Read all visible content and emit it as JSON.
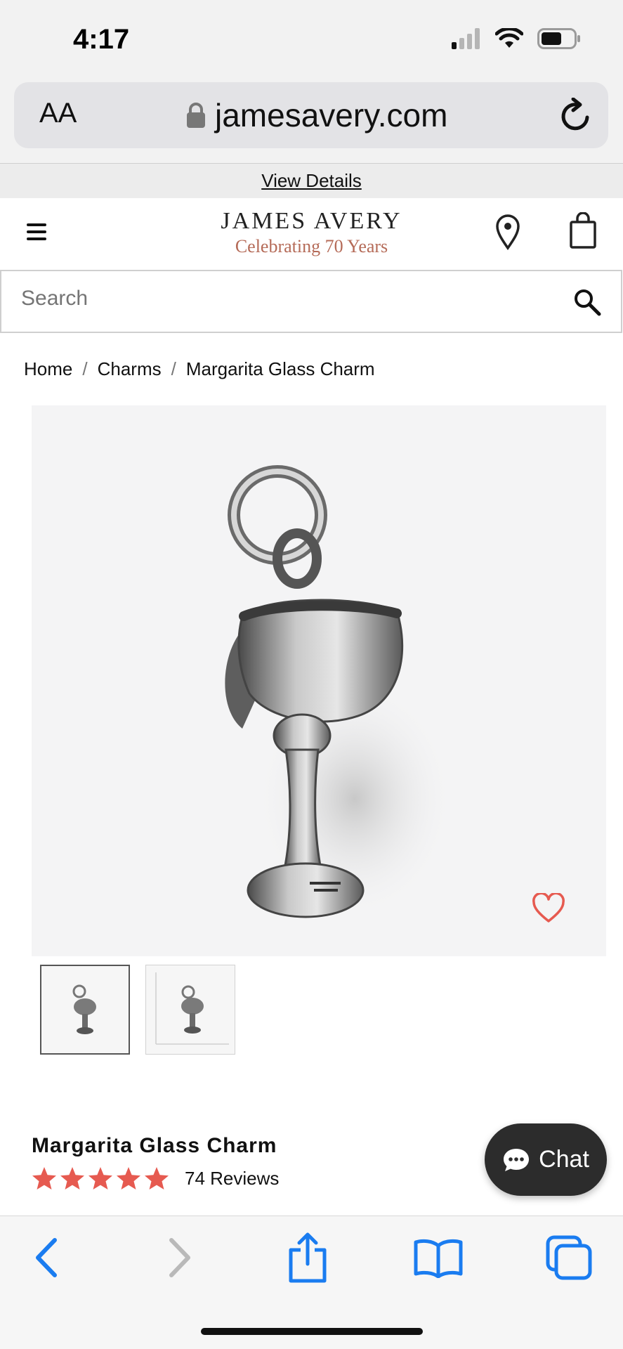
{
  "status_bar": {
    "time": "4:17"
  },
  "browser": {
    "text_size_label": "AA",
    "url": "jamesavery.com"
  },
  "promo_banner": {
    "link_label": "View Details"
  },
  "header": {
    "brand_name": "JAMES AVERY",
    "tagline": "Celebrating 70 Years"
  },
  "search": {
    "placeholder": "Search"
  },
  "breadcrumb": {
    "items": [
      "Home",
      "Charms",
      "Margarita Glass Charm"
    ],
    "separator": "/"
  },
  "product": {
    "title": "Margarita Glass Charm",
    "rating": 5,
    "reviews_label": "74 Reviews",
    "thumbnail_count": 2
  },
  "chat": {
    "label": "Chat"
  },
  "colors": {
    "accent": "#e65a50",
    "tagline": "#b56b58",
    "safari_blue": "#1a7cf0",
    "chat_bg": "#2c2c2c"
  },
  "icons": {
    "status": [
      "signal-icon",
      "wifi-icon",
      "battery-icon"
    ],
    "toolbar": [
      "back-icon",
      "forward-icon",
      "share-icon",
      "bookmarks-icon",
      "tabs-icon"
    ]
  }
}
